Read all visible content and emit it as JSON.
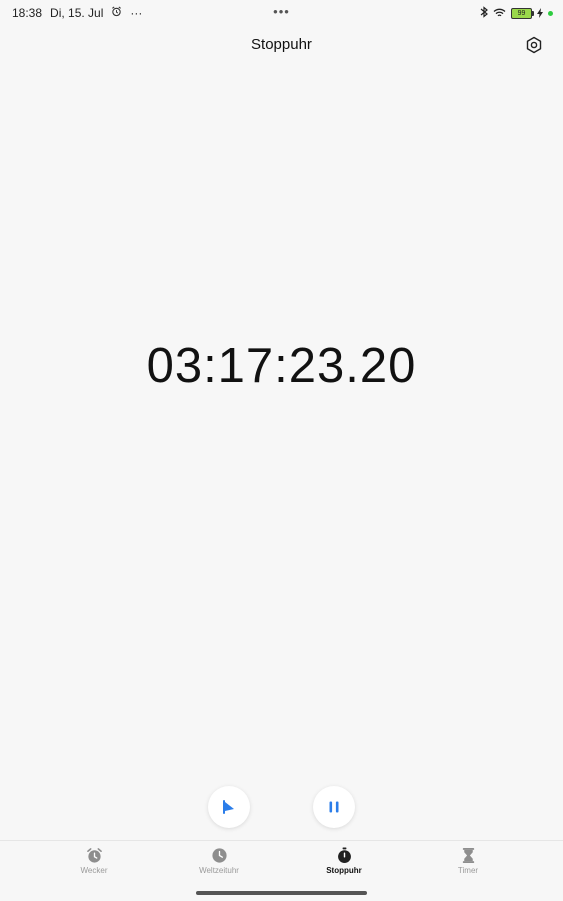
{
  "status_bar": {
    "time": "18:38",
    "date": "Di, 15. Jul",
    "more": "···",
    "center_dots": "•••",
    "battery": "99"
  },
  "header": {
    "title": "Stoppuhr"
  },
  "stopwatch": {
    "time": "03:17:23.20"
  },
  "tabs": [
    {
      "label": "Wecker",
      "icon": "alarm-clock-icon"
    },
    {
      "label": "Weltzeituhr",
      "icon": "clock-icon"
    },
    {
      "label": "Stoppuhr",
      "icon": "stopwatch-icon",
      "active": true
    },
    {
      "label": "Timer",
      "icon": "hourglass-icon"
    }
  ],
  "colors": {
    "accent": "#2b7de9",
    "background": "#f7f7f7",
    "battery": "#9ad84b"
  }
}
